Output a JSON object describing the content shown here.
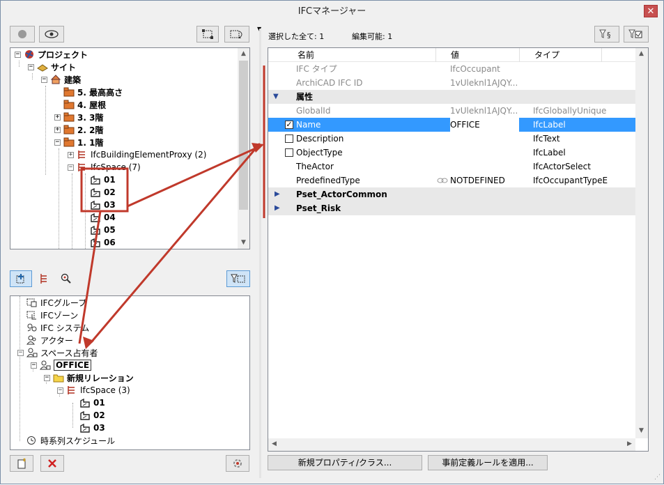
{
  "window": {
    "title": "IFCマネージャー",
    "close_glyph": "✕"
  },
  "status": {
    "selected": "選択した全て: 1",
    "editable": "編集可能: 1"
  },
  "top_tree": {
    "items": [
      {
        "label": "プロジェクト",
        "icon": "project-icon"
      },
      {
        "label": "サイト",
        "icon": "site-icon"
      },
      {
        "label": "建築",
        "icon": "building-icon"
      },
      {
        "label": "5. 最高高さ",
        "icon": "storey-icon"
      },
      {
        "label": "4. 屋根",
        "icon": "storey-icon"
      },
      {
        "label": "3. 3階",
        "icon": "storey-icon"
      },
      {
        "label": "2. 2階",
        "icon": "storey-icon"
      },
      {
        "label": "1. 1階",
        "icon": "storey-icon"
      },
      {
        "label": "IfcBuildingElementProxy (2)",
        "icon": "element-type-icon"
      },
      {
        "label": "IfcSpace (7)",
        "icon": "element-type-icon"
      },
      {
        "label": "01",
        "icon": "space-icon"
      },
      {
        "label": "02",
        "icon": "space-icon"
      },
      {
        "label": "03",
        "icon": "space-icon"
      },
      {
        "label": "04",
        "icon": "space-icon"
      },
      {
        "label": "05",
        "icon": "space-icon"
      },
      {
        "label": "06",
        "icon": "space-icon"
      }
    ]
  },
  "bottom_tree": {
    "items": [
      {
        "label": "IFCグループ",
        "icon": "group-icon"
      },
      {
        "label": "IFCゾーン",
        "icon": "zone-icon"
      },
      {
        "label": "IFC システム",
        "icon": "system-icon"
      },
      {
        "label": "アクター",
        "icon": "actor-icon"
      },
      {
        "label": "スペース占有者",
        "icon": "occupant-icon"
      },
      {
        "label": "OFFICE",
        "icon": "occupant-icon"
      },
      {
        "label": "新規リレーション",
        "icon": "folder-icon"
      },
      {
        "label": "IfcSpace (3)",
        "icon": "element-type-icon"
      },
      {
        "label": "01",
        "icon": "space-icon"
      },
      {
        "label": "02",
        "icon": "space-icon"
      },
      {
        "label": "03",
        "icon": "space-icon"
      },
      {
        "label": "時系列スケジュール",
        "icon": "schedule-icon"
      }
    ]
  },
  "grid": {
    "headers": {
      "name": "名前",
      "value": "値",
      "type": "タイプ"
    },
    "rows": [
      {
        "name": "IFC タイプ",
        "value": "IfcOccupant",
        "type": ""
      },
      {
        "name": "ArchiCAD IFC ID",
        "value": "1vUleknl1AJQY...",
        "type": ""
      },
      {
        "name": "属性",
        "value": "",
        "type": ""
      },
      {
        "name": "GlobalId",
        "value": "1vUleknl1AJQY...",
        "type": "IfcGloballyUnique"
      },
      {
        "name": "Name",
        "value": "OFFICE",
        "type": "IfcLabel"
      },
      {
        "name": "Description",
        "value": "",
        "type": "IfcText"
      },
      {
        "name": "ObjectType",
        "value": "",
        "type": "IfcLabel"
      },
      {
        "name": "TheActor",
        "value": "",
        "type": "IfcActorSelect"
      },
      {
        "name": "PredefinedType",
        "value": "NOTDEFINED",
        "type": "IfcOccupantTypeE"
      },
      {
        "name": "Pset_ActorCommon",
        "value": "",
        "type": ""
      },
      {
        "name": "Pset_Risk",
        "value": "",
        "type": ""
      }
    ]
  },
  "buttons": {
    "new_property": "新規プロパティ/クラス...",
    "apply_rules": "事前定義ルールを適用..."
  },
  "colors": {
    "accent_red": "#c0392b",
    "selection_blue": "#3399ff"
  }
}
